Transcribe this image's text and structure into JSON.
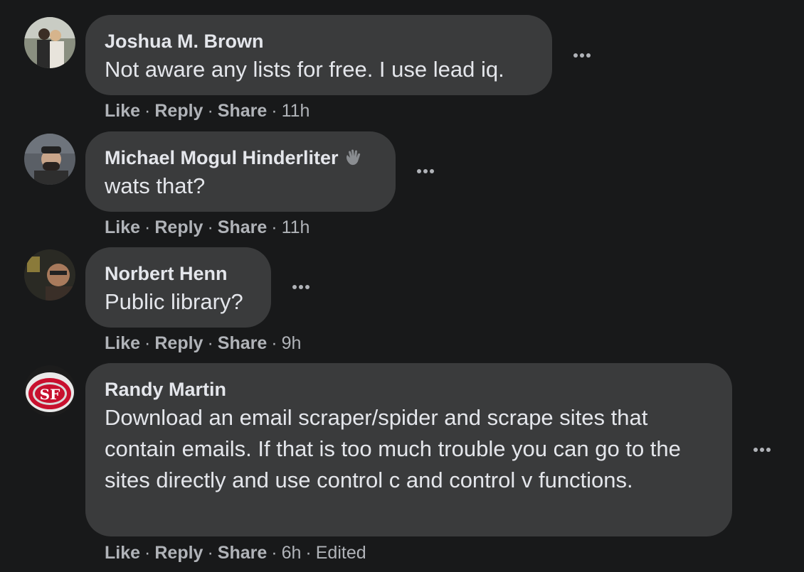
{
  "comments": [
    {
      "author": "Joshua M. Brown",
      "text": "Not aware any lists for free. I use lead iq.",
      "like": "Like",
      "reply": "Reply",
      "share": "Share",
      "time": "11h",
      "edited": ""
    },
    {
      "author": "Michael Mogul Hinderliter",
      "text": "wats that?",
      "like": "Like",
      "reply": "Reply",
      "share": "Share",
      "time": "11h",
      "edited": "",
      "badge_icon": "waving-hand-icon"
    },
    {
      "author": "Norbert Henn",
      "text": "Public library?",
      "like": "Like",
      "reply": "Reply",
      "share": "Share",
      "time": "9h",
      "edited": ""
    },
    {
      "author": "Randy Martin",
      "text": "Download an email scraper/spider and scrape sites that contain emails. If that is too much trouble you can go to the sites directly and use control c and control v functions.",
      "like": "Like",
      "reply": "Reply",
      "share": "Share",
      "time": "6h",
      "edited": "Edited"
    }
  ],
  "colors": {
    "background": "#18191a",
    "bubble": "#3a3b3c",
    "primary_text": "#e4e6eb",
    "secondary_text": "#b0b3b8"
  }
}
